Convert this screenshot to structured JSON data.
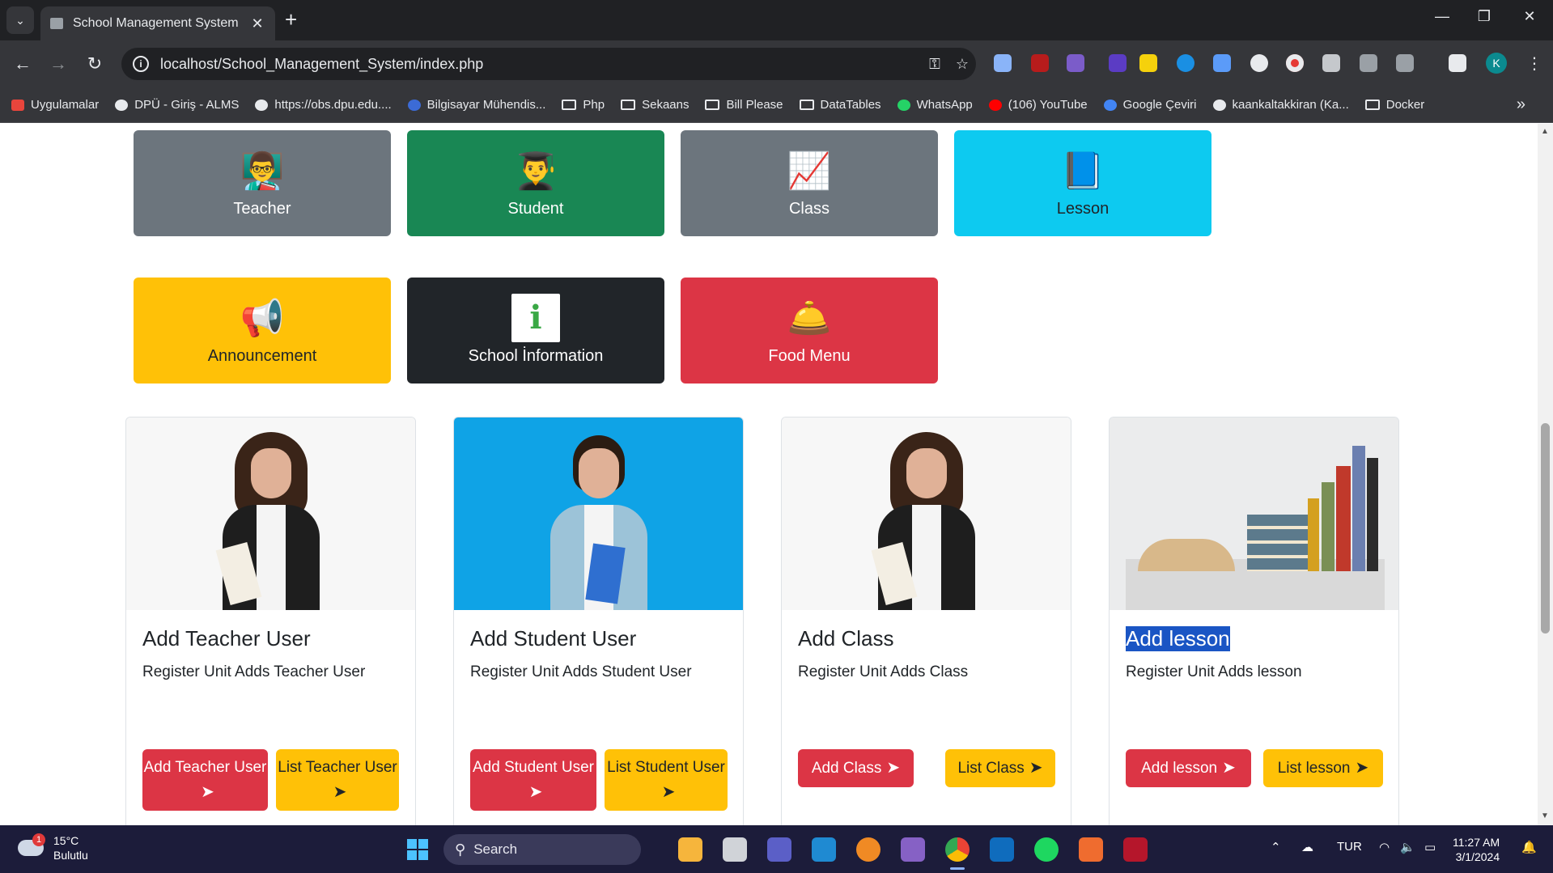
{
  "browser": {
    "tab_title": "School Management System",
    "tab_close": "✕",
    "new_tab": "+",
    "url": "localhost/School_Management_System/index.php",
    "win_minimize": "—",
    "win_restore": "❐",
    "win_close": "✕",
    "profile_initial": "K",
    "nav_back": "←",
    "nav_forward": "→",
    "nav_reload": "↻",
    "bookmarks_more": "»",
    "bookmarks": [
      {
        "label": "Uygulamalar",
        "icon": "apps-grid-icon",
        "color": "#e8453c"
      },
      {
        "label": "DPÜ - Giriş - ALMS",
        "icon": "globe-icon",
        "color": "#e8eaed"
      },
      {
        "label": "https://obs.dpu.edu....",
        "icon": "globe-icon",
        "color": "#e8eaed"
      },
      {
        "label": "Bilgisayar Mühendis...",
        "icon": "info-icon",
        "color": "#3c6bd6"
      },
      {
        "label": "Php",
        "icon": "folder-icon",
        "color": ""
      },
      {
        "label": "Sekaans",
        "icon": "folder-icon",
        "color": ""
      },
      {
        "label": "Bill Please",
        "icon": "folder-icon",
        "color": ""
      },
      {
        "label": "DataTables",
        "icon": "folder-icon",
        "color": ""
      },
      {
        "label": "WhatsApp",
        "icon": "whatsapp-icon",
        "color": "#25d366"
      },
      {
        "label": "(106) YouTube",
        "icon": "youtube-icon",
        "color": "#ff0000"
      },
      {
        "label": "Google Çeviri",
        "icon": "translate-icon",
        "color": "#4285f4"
      },
      {
        "label": "kaankaltakkiran (Ka...",
        "icon": "github-icon",
        "color": "#e8eaed"
      },
      {
        "label": "Docker",
        "icon": "folder-icon",
        "color": ""
      }
    ]
  },
  "tiles": [
    {
      "label": "Teacher",
      "icon": "teacher-icon",
      "bg": "#6c757d",
      "color": "#ffffff",
      "glyph": "👨‍🏫"
    },
    {
      "label": "Student",
      "icon": "student-icon",
      "bg": "#198754",
      "color": "#ffffff",
      "glyph": "👨‍🎓"
    },
    {
      "label": "Class",
      "icon": "chart-board-icon",
      "bg": "#6c757d",
      "color": "#ffffff",
      "glyph": "📈"
    },
    {
      "label": "Lesson",
      "icon": "notebook-icon",
      "bg": "#0dcaf0",
      "color": "#212529",
      "glyph": "📘"
    },
    {
      "label": "Announcement",
      "icon": "megaphone-icon",
      "bg": "#ffc107",
      "color": "#212529",
      "glyph": "📢"
    },
    {
      "label": "School İnformation",
      "icon": "information-icon",
      "bg": "#212529",
      "color": "#ffffff",
      "glyph": "ℹ️"
    },
    {
      "label": "Food Menu",
      "icon": "food-menu-icon",
      "bg": "#dc3545",
      "color": "#ffffff",
      "glyph": "🛎️"
    }
  ],
  "cards": [
    {
      "title": "Add Teacher User",
      "text": "Register Unit Adds Teacher User",
      "add_label": "Add Teacher User",
      "list_label": "List Teacher User",
      "image": "teacher-photo"
    },
    {
      "title": "Add Student User",
      "text": "Register Unit Adds Student User",
      "add_label": "Add Student User",
      "list_label": "List Student User",
      "image": "student-photo"
    },
    {
      "title": "Add Class",
      "text": "Register Unit Adds Class",
      "add_label": "Add Class",
      "list_label": "List Class",
      "image": "teacher-photo"
    },
    {
      "title": "Add lesson",
      "text": "Register Unit Adds lesson",
      "add_label": "Add lesson",
      "list_label": "List lesson",
      "image": "books-photo"
    }
  ],
  "taskbar": {
    "temperature": "15°C",
    "weather_desc": "Bulutlu",
    "notification_count": "1",
    "search_label": "Search",
    "language": "TUR",
    "time": "11:27 AM",
    "date": "3/1/2024"
  }
}
